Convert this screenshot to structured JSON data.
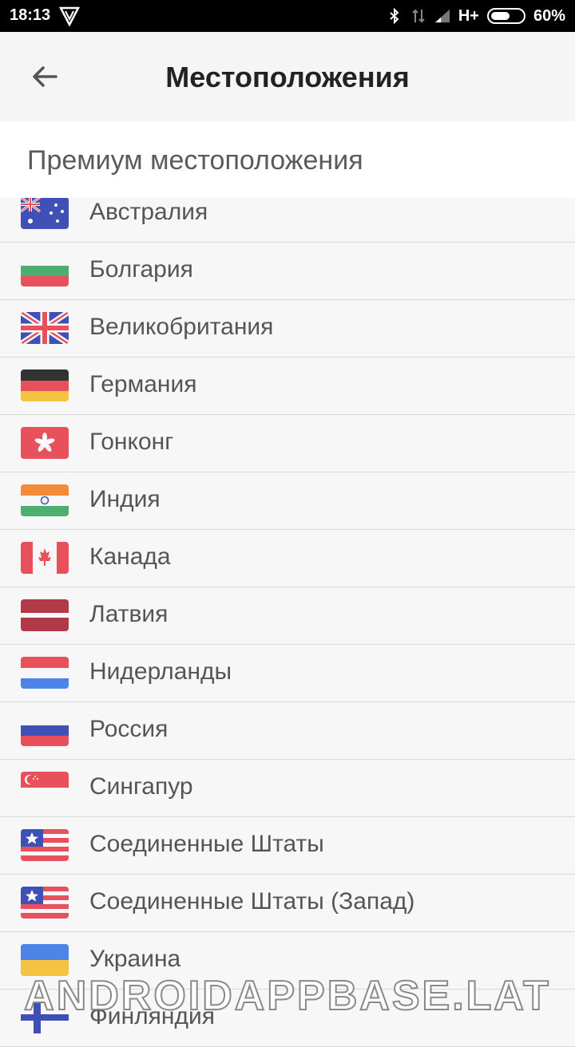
{
  "status": {
    "time": "18:13",
    "network": "H+",
    "battery": "60%",
    "battery_level": 0.6
  },
  "header": {
    "title": "Местоположения"
  },
  "section": {
    "title": "Премиум местоположения"
  },
  "countries": [
    {
      "name": "Австралия",
      "flag": "australia-flag"
    },
    {
      "name": "Болгария",
      "flag": "bulgaria-flag"
    },
    {
      "name": "Великобритания",
      "flag": "uk-flag"
    },
    {
      "name": "Германия",
      "flag": "germany-flag"
    },
    {
      "name": "Гонконг",
      "flag": "hongkong-flag"
    },
    {
      "name": "Индия",
      "flag": "india-flag"
    },
    {
      "name": "Канада",
      "flag": "canada-flag"
    },
    {
      "name": "Латвия",
      "flag": "latvia-flag"
    },
    {
      "name": "Нидерланды",
      "flag": "netherlands-flag"
    },
    {
      "name": "Россия",
      "flag": "russia-flag"
    },
    {
      "name": "Сингапур",
      "flag": "singapore-flag"
    },
    {
      "name": "Соединенные Штаты",
      "flag": "usa-flag"
    },
    {
      "name": "Соединенные Штаты (Запад)",
      "flag": "usa-flag"
    },
    {
      "name": "Украина",
      "flag": "ukraine-flag"
    },
    {
      "name": "Финляндия",
      "flag": "finland-flag"
    }
  ],
  "watermark": "ANDROIDAPPBASE.LAT"
}
